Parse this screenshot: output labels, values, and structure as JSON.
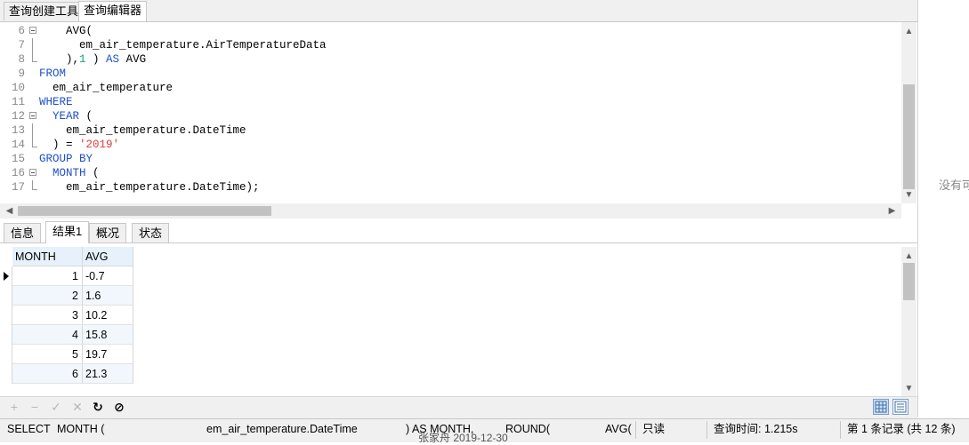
{
  "top_tabs": [
    "查询创建工具",
    "查询编辑器"
  ],
  "editor_lines": [
    {
      "num": "6",
      "fold": "open",
      "segs": [
        {
          "t": "    AVG("
        }
      ]
    },
    {
      "num": "7",
      "fold": "line",
      "segs": [
        {
          "t": "      em_air_temperature.AirTemperatureData"
        }
      ]
    },
    {
      "num": "8",
      "fold": "end",
      "segs": [
        {
          "t": "    ),"
        },
        {
          "t": "1",
          "c": "num"
        },
        {
          "t": " ) "
        },
        {
          "t": "AS",
          "c": "kw"
        },
        {
          "t": " AVG"
        }
      ]
    },
    {
      "num": "9",
      "fold": "",
      "segs": [
        {
          "t": "FROM",
          "c": "kw"
        }
      ]
    },
    {
      "num": "10",
      "fold": "",
      "segs": [
        {
          "t": "  em_air_temperature"
        }
      ]
    },
    {
      "num": "11",
      "fold": "",
      "segs": [
        {
          "t": "WHERE",
          "c": "kw"
        }
      ]
    },
    {
      "num": "12",
      "fold": "open",
      "segs": [
        {
          "t": "  "
        },
        {
          "t": "YEAR",
          "c": "kw"
        },
        {
          "t": " ("
        }
      ]
    },
    {
      "num": "13",
      "fold": "line",
      "segs": [
        {
          "t": "    em_air_temperature.DateTime"
        }
      ]
    },
    {
      "num": "14",
      "fold": "end",
      "segs": [
        {
          "t": "  ) = "
        },
        {
          "t": "'2019'",
          "c": "str"
        }
      ]
    },
    {
      "num": "15",
      "fold": "",
      "segs": [
        {
          "t": "GROUP BY",
          "c": "kw"
        }
      ]
    },
    {
      "num": "16",
      "fold": "open",
      "segs": [
        {
          "t": "  "
        },
        {
          "t": "MONTH",
          "c": "kw"
        },
        {
          "t": " ("
        }
      ]
    },
    {
      "num": "17",
      "fold": "end",
      "segs": [
        {
          "t": "    em_air_temperature.DateTime);"
        }
      ]
    }
  ],
  "bottom_tabs": [
    "信息",
    "结果1",
    "概况",
    "状态"
  ],
  "active_bottom_tab": 1,
  "grid": {
    "columns": [
      "MONTH",
      "AVG"
    ],
    "rows": [
      {
        "month": "1",
        "avg": "-0.7"
      },
      {
        "month": "2",
        "avg": "1.6"
      },
      {
        "month": "3",
        "avg": "10.2"
      },
      {
        "month": "4",
        "avg": "15.8"
      },
      {
        "month": "5",
        "avg": "19.7"
      },
      {
        "month": "6",
        "avg": "21.3"
      }
    ]
  },
  "toolbar": {
    "add": "+",
    "remove": "−",
    "apply": "✓",
    "discard": "✕",
    "refresh": "↻",
    "stop": "⊘"
  },
  "status": {
    "sql_1": "SELECT",
    "sql_2": "MONTH (",
    "sql_3": "em_air_temperature.DateTime",
    "sql_4": ") AS MONTH,",
    "sql_5": "ROUND(",
    "sql_6": "AVG(",
    "readonly": "只读",
    "query_time": "查询时间: 1.215s",
    "records": "第 1 条记录 (共 12 条)"
  },
  "overlap_text": "张家舟  2019-12-30",
  "right_pane_text": "没有可"
}
